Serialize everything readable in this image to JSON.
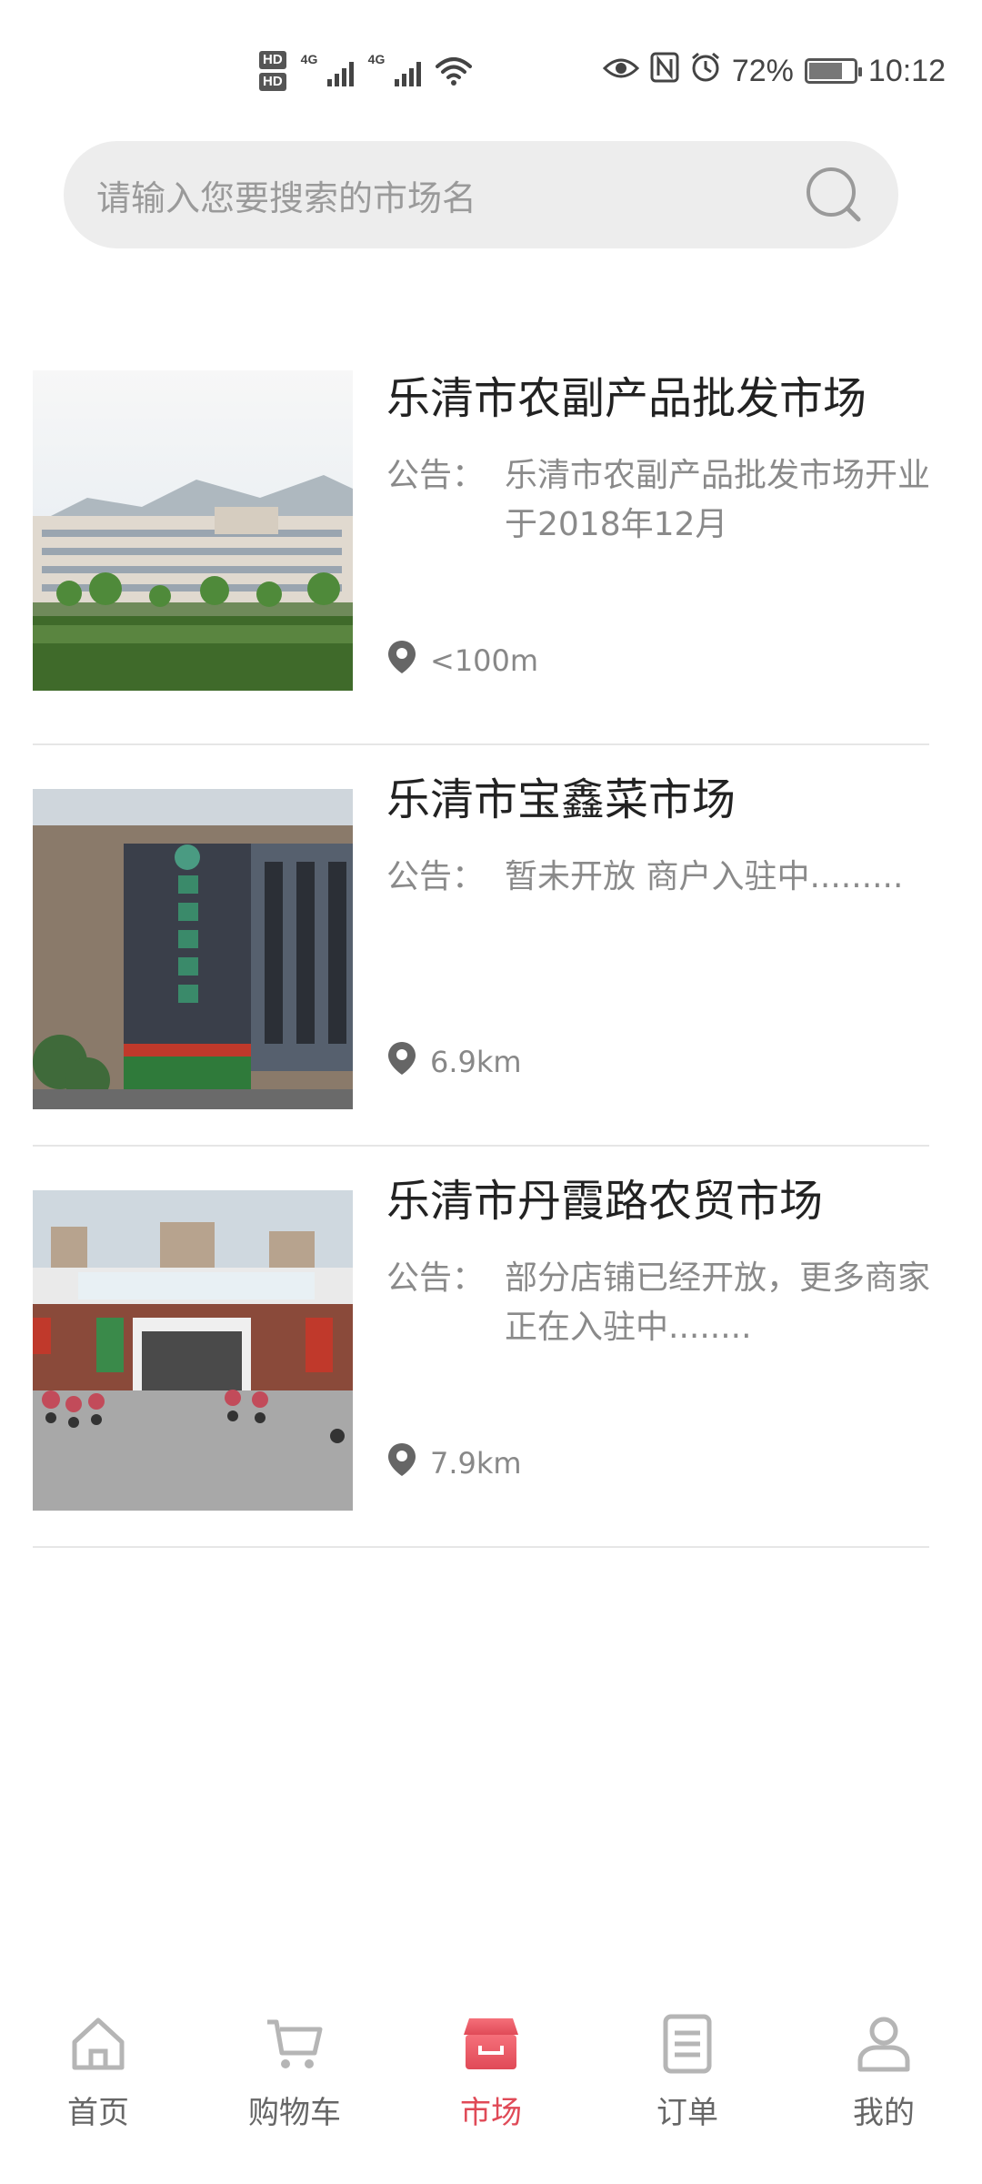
{
  "status_bar": {
    "hd1": "HD",
    "hd2": "HD",
    "sim1_network": "4G",
    "sim2_network": "4G",
    "battery_percent": "72%",
    "time": "10:12",
    "battery_level": 0.72,
    "icons": [
      "eye-icon",
      "nfc-icon",
      "alarm-icon",
      "wifi-icon",
      "battery-icon"
    ]
  },
  "search": {
    "placeholder": "请输入您要搜索的市场名"
  },
  "markets": [
    {
      "name": "乐清市农副产品批发市场",
      "notice_label": "公告：",
      "notice": "乐清市农副产品批发市场开业于2018年12月",
      "distance": "<100m"
    },
    {
      "name": "乐清市宝鑫菜市场",
      "notice_label": "公告：",
      "notice": "暂未开放 商户入驻中.........",
      "distance": "6.9km"
    },
    {
      "name": "乐清市丹霞路农贸市场",
      "notice_label": "公告：",
      "notice": "部分店铺已经开放，更多商家正在入驻中........",
      "distance": "7.9km"
    }
  ],
  "nav": {
    "items": [
      {
        "label": "首页",
        "icon": "home-icon"
      },
      {
        "label": "购物车",
        "icon": "cart-icon"
      },
      {
        "label": "市场",
        "icon": "market-icon",
        "active": true
      },
      {
        "label": "订单",
        "icon": "order-icon"
      },
      {
        "label": "我的",
        "icon": "profile-icon"
      }
    ],
    "active_color": "#e04a57",
    "inactive_color": "#b5b5b5"
  }
}
